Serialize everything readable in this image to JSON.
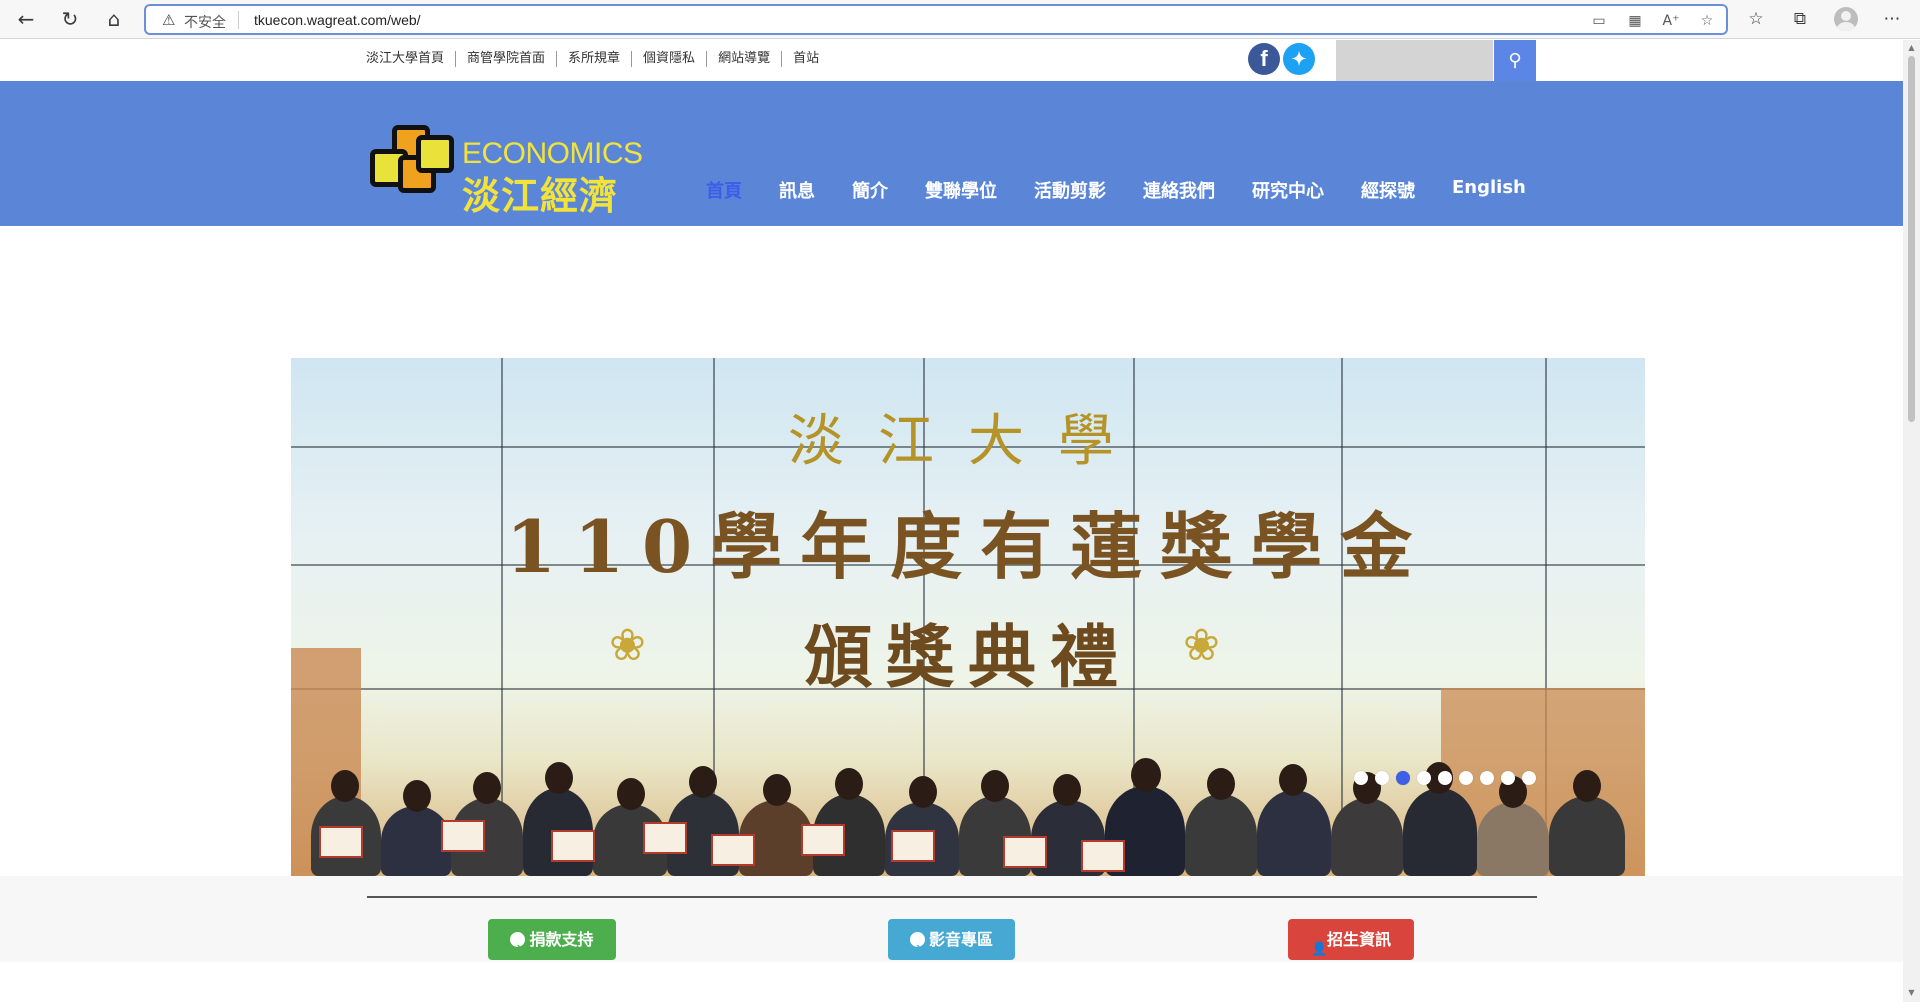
{
  "browser": {
    "insecure_label": "不安全",
    "url": "tkuecon.wagreat.com/web/",
    "icons": [
      "back-icon",
      "reload-icon",
      "home-icon",
      "warning-icon",
      "read-view-icon",
      "qr-icon",
      "read-aloud-icon",
      "favorite-add-icon",
      "favorites-icon",
      "collections-icon",
      "profile-icon",
      "more-icon"
    ]
  },
  "toplinks": [
    {
      "label": "淡江大學首頁"
    },
    {
      "label": "商管學院首面"
    },
    {
      "label": "系所規章"
    },
    {
      "label": "個資隱私"
    },
    {
      "label": "網站導覽"
    },
    {
      "label": "首站"
    }
  ],
  "social": {
    "facebook": "f",
    "twitter": "t"
  },
  "search": {
    "placeholder": ""
  },
  "logo": {
    "line1": "ECONOMICS",
    "line2": "淡江經濟"
  },
  "nav": [
    {
      "label": "首頁",
      "active": true
    },
    {
      "label": "訊息"
    },
    {
      "label": "簡介"
    },
    {
      "label": "雙聯學位"
    },
    {
      "label": "活動剪影"
    },
    {
      "label": "連絡我們"
    },
    {
      "label": "研究中心"
    },
    {
      "label": "經探號"
    },
    {
      "label": "English"
    }
  ],
  "slide": {
    "line1": "淡江大學",
    "line2": "110學年度有蓮獎學金",
    "line3": "頒獎典禮"
  },
  "carousel": {
    "count": 9,
    "active_index": 2
  },
  "cta": {
    "donate": "捐款支持",
    "video": "影音專區",
    "admission": "招生資訊"
  },
  "colors": {
    "header": "#5b86d8",
    "active_nav": "#3a5ee8",
    "green": "#4cae4c",
    "blue": "#46a9d3",
    "red": "#d9443c"
  }
}
